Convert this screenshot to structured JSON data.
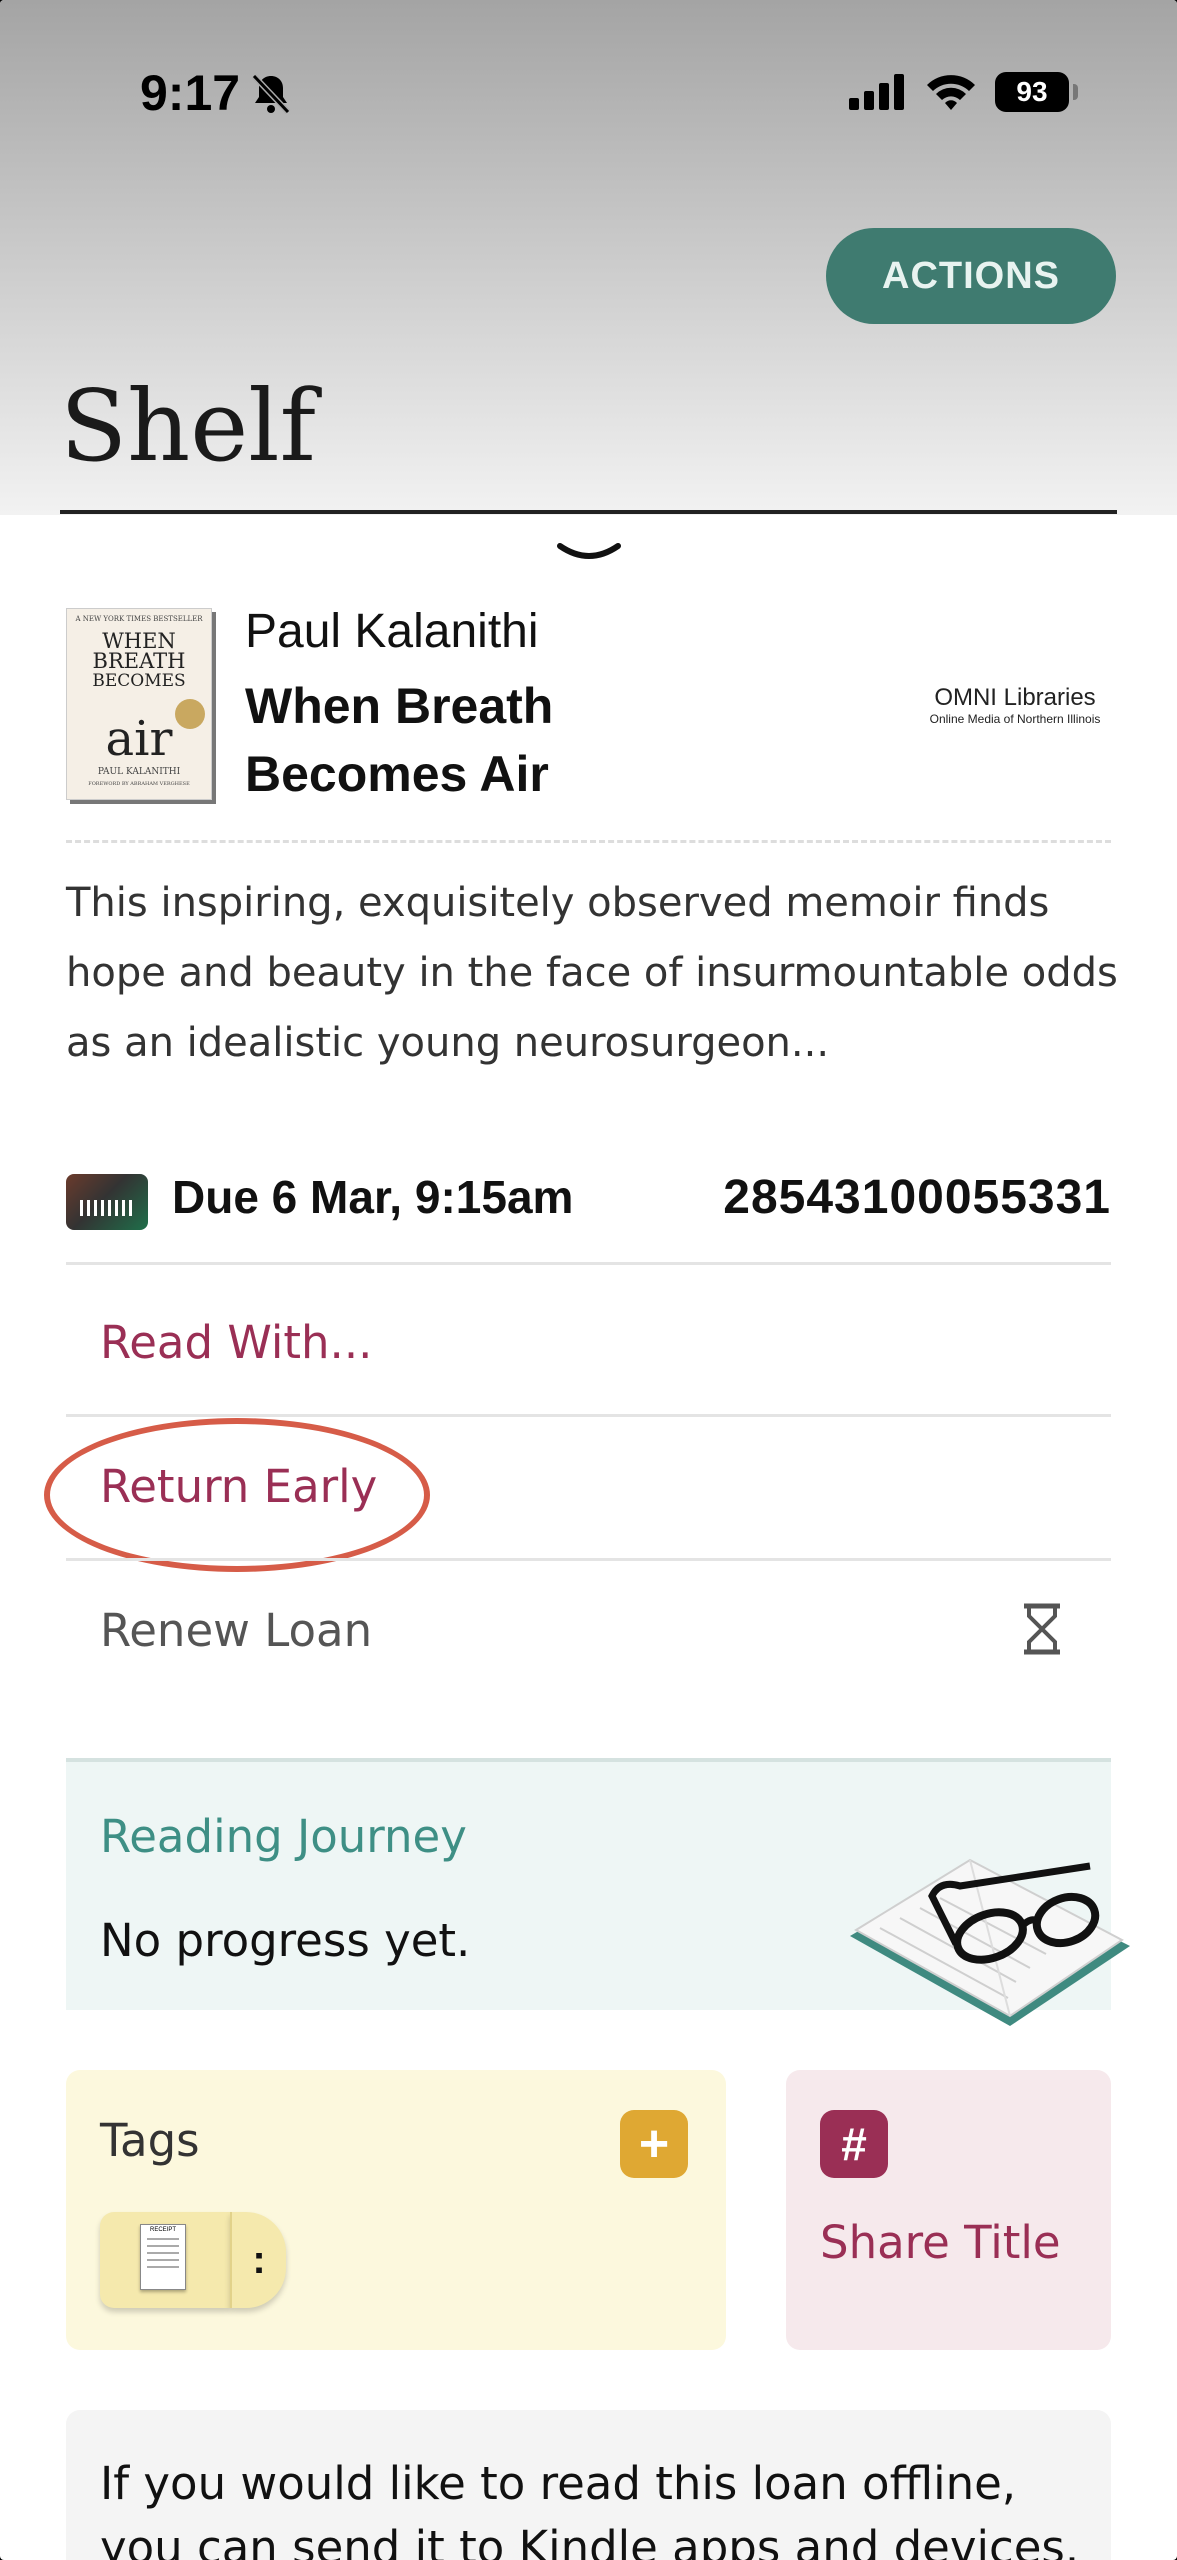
{
  "status_bar": {
    "time": "9:17",
    "battery": "93",
    "icons": [
      "bell-slash-icon",
      "signal-icon",
      "wifi-icon",
      "battery-icon"
    ]
  },
  "header": {
    "actions_label": "ACTIONS",
    "title": "Shelf"
  },
  "book": {
    "author": "Paul Kalanithi",
    "title": "When Breath Becomes Air",
    "cover": {
      "top_line": "A NEW YORK TIMES BESTSELLER",
      "words": [
        "WHEN",
        "BREATH",
        "BECOMES"
      ],
      "air": "air",
      "author": "PAUL KALANITHI",
      "foreword": "FOREWORD BY ABRAHAM VERGHESE"
    },
    "library_name": "OMNI Libraries",
    "library_subtitle": "Online Media of Northern Illinois",
    "description": "This inspiring, exquisitely observed memoir finds hope and beauty in the face of insurmountable odds as an idealistic young neurosurgeon..."
  },
  "loan": {
    "due": "Due 6 Mar, 9:15am",
    "id": "28543100055331"
  },
  "options": {
    "read_with": "Read With...",
    "return_early": "Return Early",
    "renew": "Renew Loan"
  },
  "journey": {
    "title": "Reading Journey",
    "progress": "No progress yet."
  },
  "tags": {
    "title": "Tags",
    "add": "+",
    "menu": ":",
    "receipt_label": "RECEIPT"
  },
  "share": {
    "icon": "#",
    "label": "Share Title"
  },
  "offline": {
    "text": "If you would like to read this loan offline, you can send it to Kindle apps and devices."
  },
  "colors": {
    "accent_green": "#3f7b70",
    "accent_red": "#9a2f55",
    "highlight_circle": "#d65c48"
  }
}
